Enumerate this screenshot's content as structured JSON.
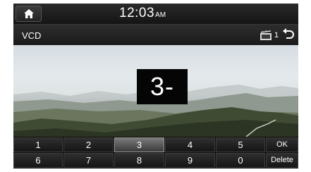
{
  "status": {
    "time": "12:03",
    "ampm": "AM"
  },
  "header": {
    "title": "VCD",
    "disc_count": "1"
  },
  "video": {
    "track_entry": "3-"
  },
  "keypad": {
    "row1": [
      "1",
      "2",
      "3",
      "4",
      "5",
      "OK"
    ],
    "row2": [
      "6",
      "7",
      "8",
      "9",
      "0",
      "Delete"
    ],
    "active_key": "3"
  },
  "icons": [
    "home-icon",
    "disc-icon",
    "back-arrow-icon"
  ]
}
